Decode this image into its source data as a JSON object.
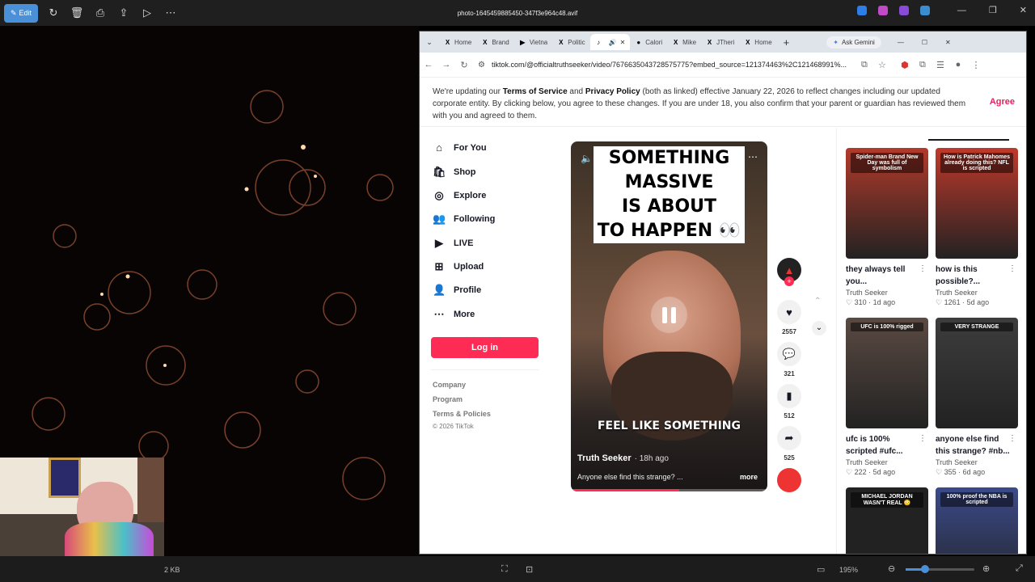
{
  "viewer": {
    "edit_label": "Edit",
    "filename": "photo-1645459885450-347f3e964c48.avif",
    "file_size": "2 KB",
    "zoom": "195%"
  },
  "browser": {
    "tabs": [
      {
        "icon": "X",
        "label": "Home"
      },
      {
        "icon": "X",
        "label": "Brand"
      },
      {
        "icon": "▶",
        "label": "Vietna"
      },
      {
        "icon": "X",
        "label": "Politic"
      },
      {
        "icon": "♪",
        "label": ""
      },
      {
        "icon": "●",
        "label": "Calori"
      },
      {
        "icon": "X",
        "label": "Mike"
      },
      {
        "icon": "X",
        "label": "JTheri"
      },
      {
        "icon": "X",
        "label": "Home"
      }
    ],
    "gemini_label": "Ask Gemini",
    "url": "tiktok.com/@officialtruthseeker/video/7676635043728575775?embed_source=121374463%2C121468991%..."
  },
  "tos": {
    "t1": "We're updating our ",
    "terms": "Terms of Service",
    "t2": " and ",
    "privacy": "Privacy Policy",
    "t3": " (both as linked) effective January 22, 2026 to reflect changes including our updated corporate entity. By clicking below, you agree to these changes. If you are under 18, you also confirm that your parent or guardian has reviewed them with you and agreed to them.",
    "agree": "Agree"
  },
  "nav": {
    "items": [
      {
        "label": "For You"
      },
      {
        "label": "Shop"
      },
      {
        "label": "Explore"
      },
      {
        "label": "Following"
      },
      {
        "label": "LIVE"
      },
      {
        "label": "Upload"
      },
      {
        "label": "Profile"
      },
      {
        "label": "More"
      }
    ],
    "login": "Log in",
    "footer": [
      "Company",
      "Program",
      "Terms & Policies"
    ],
    "copyright": "© 2026 TikTok"
  },
  "video": {
    "caption_lines": [
      "SOMETHING",
      "MASSIVE",
      "IS ABOUT",
      "TO HAPPEN 👀"
    ],
    "subtitle": "FEEL LIKE SOMETHING",
    "author": "Truth Seeker",
    "time": "· 18h ago",
    "description": "Anyone else find this strange? ...",
    "more": "more",
    "progress": 0.55
  },
  "actions": {
    "likes": "2557",
    "comments": "321",
    "saves": "512",
    "shares": "525"
  },
  "related": [
    {
      "thumb_text": "Spider-man Brand New Day was full of symbolism",
      "title": "they always tell you...",
      "author": "Truth Seeker",
      "views": "310",
      "age": "· 1d ago",
      "color": "#b33a2a"
    },
    {
      "thumb_text": "How is Patrick Mahomes already doing this? NFL is scripted",
      "title": "how is this possible?...",
      "author": "Truth Seeker",
      "views": "1261",
      "age": "· 5d ago",
      "color": "#c0392b"
    },
    {
      "thumb_text": "UFC is 100% rigged",
      "title": "ufc is 100% scripted #ufc...",
      "author": "Truth Seeker",
      "views": "222",
      "age": "· 5d ago",
      "color": "#5a4a42"
    },
    {
      "thumb_text": "VERY STRANGE",
      "title": "anyone else find this strange? #nb...",
      "author": "Truth Seeker",
      "views": "355",
      "age": "· 6d ago",
      "color": "#3d3d3d"
    },
    {
      "thumb_text": "MICHAEL JORDAN WASN'T REAL 😳",
      "title": "",
      "author": "",
      "views": "",
      "age": "",
      "color": "#222"
    },
    {
      "thumb_text": "100% proof the NBA is scripted",
      "title": "",
      "author": "",
      "views": "",
      "age": "",
      "color": "#3b4a8a"
    }
  ]
}
